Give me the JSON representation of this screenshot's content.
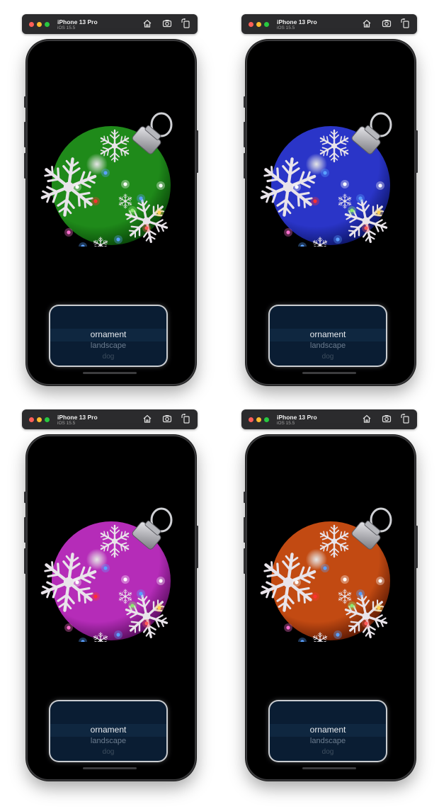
{
  "simulators": [
    {
      "device": "iPhone 13 Pro",
      "os": "iOS 15.5",
      "ornament_color": "#1f8a1a",
      "ornament_dark": "#053a05",
      "picker": {
        "selected": "ornament",
        "options": [
          "landscape",
          "dog"
        ]
      }
    },
    {
      "device": "iPhone 13 Pro",
      "os": "iOS 15.5",
      "ornament_color": "#2a35c8",
      "ornament_dark": "#081058",
      "picker": {
        "selected": "ornament",
        "options": [
          "landscape",
          "dog"
        ]
      }
    },
    {
      "device": "iPhone 13 Pro",
      "os": "iOS 15.5",
      "ornament_color": "#b52cb8",
      "ornament_dark": "#4a0850",
      "picker": {
        "selected": "ornament",
        "options": [
          "landscape",
          "dog"
        ]
      }
    },
    {
      "device": "iPhone 13 Pro",
      "os": "iOS 15.5",
      "ornament_color": "#c24a12",
      "ornament_dark": "#4d1202",
      "picker": {
        "selected": "ornament",
        "options": [
          "landscape",
          "dog"
        ]
      }
    }
  ],
  "toolbar_icons": [
    "home-icon",
    "screenshot-icon",
    "rotate-icon"
  ]
}
